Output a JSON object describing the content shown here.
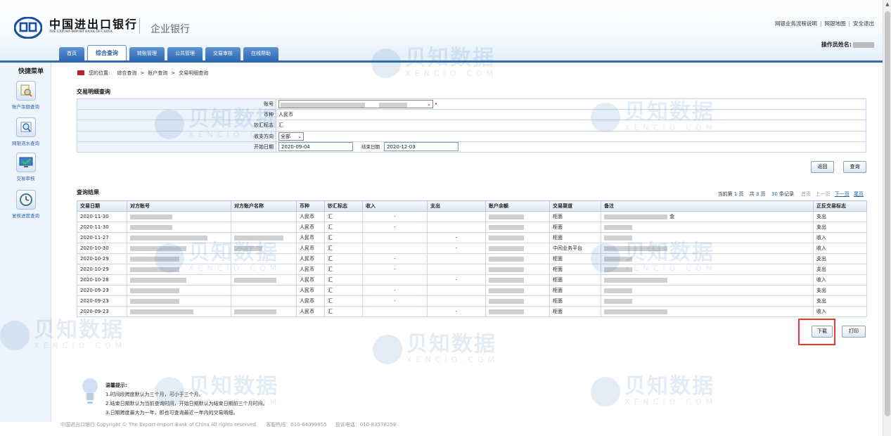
{
  "header": {
    "bank_name_cn": "中国进出口银行",
    "bank_name_en": "THE EXPORT-IMPORT BANK OF CHINA",
    "corp_bank": "企业银行",
    "links": [
      "网银业务流程说明",
      "网银地图",
      "安全退出"
    ],
    "operator_label": "操作员姓名:"
  },
  "tabs": [
    "首页",
    "综合查询",
    "转账管理",
    "公共管理",
    "交易审核",
    "在线帮助"
  ],
  "active_tab": 1,
  "sidebar": {
    "title": "快捷菜单",
    "items": [
      {
        "label": "账户余额查询",
        "icon": "search-document-icon"
      },
      {
        "label": "网银流水查询",
        "icon": "magnifier-icon"
      },
      {
        "label": "交易审核",
        "icon": "checkmark-monitor-icon"
      },
      {
        "label": "复核进度查询",
        "icon": "clock-icon"
      }
    ]
  },
  "breadcrumb": {
    "label": "您的位置:",
    "path": [
      "综合查询",
      "账户查询",
      "交易明细查询"
    ]
  },
  "query": {
    "title": "交易明细查询",
    "fields": {
      "account_label": "账号",
      "currency_label": "币种",
      "currency_value": "人民币",
      "cash_label": "钞汇标志",
      "cash_value": "汇",
      "direction_label": "收支方向",
      "direction_value": "全部",
      "start_label": "开始日期",
      "start_value": "2020-09-04",
      "end_label": "结束日期",
      "end_value": "2020-12-03"
    },
    "buttons": {
      "back": "返回",
      "query": "查询"
    }
  },
  "results": {
    "title": "查询结果",
    "pager": {
      "current_label": "当前第",
      "current": "1",
      "page_unit": "页",
      "total_label": "共",
      "total_pages": "3",
      "total_unit": "页",
      "records": "30",
      "records_unit": "条记录",
      "first": "首页",
      "prev": "上一页",
      "next": "下一页",
      "last": "尾页"
    },
    "columns": [
      "交易日期",
      "对方账号",
      "对方账户名称",
      "币种",
      "钞汇标志",
      "收入",
      "支出",
      "账户余额",
      "交易渠道",
      "备注",
      "正反交易标志"
    ],
    "rows": [
      {
        "date": "2020-11-30",
        "currency": "人民币",
        "cash": "汇",
        "income": "-",
        "expense": "",
        "channel": "柜面",
        "note": "金",
        "flag": "支出"
      },
      {
        "date": "2020-11-30",
        "currency": "人民币",
        "cash": "汇",
        "income": "-",
        "expense": "",
        "channel": "柜面",
        "note": "",
        "flag": "支出"
      },
      {
        "date": "2020-11-27",
        "currency": "人民币",
        "cash": "汇",
        "income": "",
        "expense": "-",
        "channel": "柜面",
        "note": "",
        "flag": "收入"
      },
      {
        "date": "2020-10-30",
        "currency": "人民币",
        "cash": "汇",
        "income": "",
        "expense": "-",
        "channel": "中间业务平台",
        "note": "",
        "flag": "收入"
      },
      {
        "date": "2020-10-29",
        "currency": "人民币",
        "cash": "汇",
        "income": "-",
        "expense": "",
        "channel": "柜面",
        "note": "",
        "flag": "支出"
      },
      {
        "date": "2020-10-29",
        "currency": "人民币",
        "cash": "汇",
        "income": "-",
        "expense": "",
        "channel": "柜面",
        "note": "",
        "flag": "支出"
      },
      {
        "date": "2020-10-28",
        "currency": "人民币",
        "cash": "汇",
        "income": "",
        "expense": "-",
        "channel": "柜面",
        "note": "",
        "flag": "收入"
      },
      {
        "date": "2020-09-23",
        "currency": "人民币",
        "cash": "汇",
        "income": "-",
        "expense": "",
        "channel": "柜面",
        "note": "",
        "flag": "支出"
      },
      {
        "date": "2020-09-23",
        "currency": "人民币",
        "cash": "汇",
        "income": "-",
        "expense": "",
        "channel": "柜面",
        "note": "",
        "flag": "支出"
      },
      {
        "date": "2020-09-23",
        "currency": "人民币",
        "cash": "汇",
        "income": "",
        "expense": "-",
        "channel": "柜面",
        "note": "",
        "flag": "收入"
      }
    ],
    "buttons": {
      "download": "下载",
      "print": "打印"
    }
  },
  "tips": {
    "title": "温馨提示:",
    "lines": [
      "1.时间段跨度默认为三个月，可小于三个月。",
      "2.结束日期默认为当前查询时间，开始日期默认为结束日期前三个月时间。",
      "3.日期跨度最大为一年，即也可查询最近一年内的交易明细。"
    ]
  },
  "footer": {
    "copyright": "中国进出口银行  Copyright © The Export-Import Bank of China All rights reserved.",
    "hotline": "客服热线：010-64099955",
    "complaint": "投诉电话：010-83578259"
  },
  "watermark": {
    "text": "贝知数据",
    "sub": "XENCIO.COM"
  },
  "colors": {
    "primary": "#2f6bb5",
    "highlight": "#e43a2e",
    "tab_bg": "#4a84c8"
  }
}
